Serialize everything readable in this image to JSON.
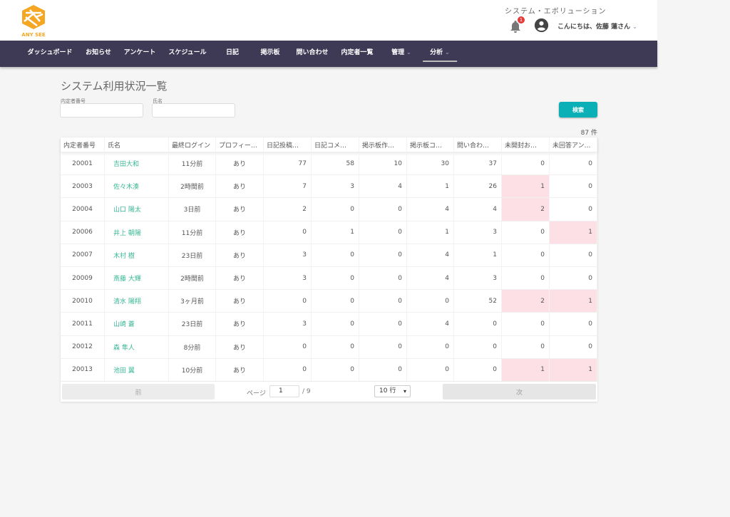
{
  "header": {
    "logo_text": "ANY SEE",
    "system_name": "システム・エボリューション",
    "notification_count": "1",
    "greeting": "こんにちは、佐藤 蓮さん"
  },
  "nav": [
    {
      "label": "ダッシュボード"
    },
    {
      "label": "お知らせ"
    },
    {
      "label": "アンケート"
    },
    {
      "label": "スケジュール"
    },
    {
      "label": "日記"
    },
    {
      "label": "掲示板"
    },
    {
      "label": "問い合わせ"
    },
    {
      "label": "内定者一覧"
    },
    {
      "label": "管理",
      "dropdown": true
    },
    {
      "label": "分析",
      "dropdown": true,
      "active": true
    }
  ],
  "page": {
    "title": "システム利用状況一覧",
    "filter_id_label": "内定者番号",
    "filter_name_label": "氏名",
    "filter_id_value": "",
    "filter_name_value": "",
    "search_label": "検索",
    "count": "87 件"
  },
  "colors": {
    "accent": "#0ab0b5",
    "nav_bg": "#3e3a56",
    "link": "#3ab795",
    "highlight": "#fde0e5"
  },
  "table": {
    "columns": [
      "内定者番号",
      "氏名",
      "最終ログイン",
      "プロフィー…",
      "日記投稿…",
      "日記コメ…",
      "掲示板作…",
      "掲示板コ…",
      "問い合わ…",
      "未開封お…",
      "未回答アン…"
    ],
    "rows": [
      [
        "20001",
        "吉田大和",
        "11分前",
        "あり",
        "77",
        "58",
        "10",
        "30",
        "37",
        "0",
        "0"
      ],
      [
        "20003",
        "佐々木湊",
        "2時間前",
        "あり",
        "7",
        "3",
        "4",
        "1",
        "26",
        "1",
        "0"
      ],
      [
        "20004",
        "山口 陽太",
        "3日前",
        "あり",
        "2",
        "0",
        "0",
        "4",
        "4",
        "2",
        "0"
      ],
      [
        "20006",
        "井上 朝陽",
        "11分前",
        "あり",
        "0",
        "1",
        "0",
        "1",
        "3",
        "0",
        "1"
      ],
      [
        "20007",
        "木村 樹",
        "23日前",
        "あり",
        "3",
        "0",
        "0",
        "4",
        "1",
        "0",
        "0"
      ],
      [
        "20009",
        "斎藤 大輝",
        "2時間前",
        "あり",
        "3",
        "0",
        "0",
        "4",
        "3",
        "0",
        "0"
      ],
      [
        "20010",
        "清水 陽翔",
        "3ヶ月前",
        "あり",
        "0",
        "0",
        "0",
        "0",
        "52",
        "2",
        "1"
      ],
      [
        "20011",
        "山崎 蒼",
        "23日前",
        "あり",
        "3",
        "0",
        "0",
        "4",
        "0",
        "0",
        "0"
      ],
      [
        "20012",
        "森 隼人",
        "8分前",
        "あり",
        "0",
        "0",
        "0",
        "0",
        "0",
        "0",
        "0"
      ],
      [
        "20013",
        "池田 翼",
        "10分前",
        "あり",
        "0",
        "0",
        "0",
        "0",
        "0",
        "1",
        "1"
      ]
    ]
  },
  "pager": {
    "prev": "前",
    "next": "次",
    "page_label": "ページ",
    "page": "1",
    "total": "/ 9",
    "rows_per_page": "10 行"
  }
}
